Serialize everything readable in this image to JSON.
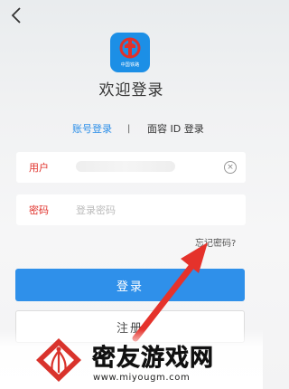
{
  "header": {
    "back_label": "<"
  },
  "app": {
    "logo_caption": "中国铁路",
    "title": "欢迎登录"
  },
  "tabs": [
    {
      "label": "账号登录",
      "active": true
    },
    {
      "label": "面容 ID 登录",
      "active": false
    }
  ],
  "tab_separator": "|",
  "form": {
    "username_label": "用户",
    "password_label": "密码",
    "password_placeholder": "登录密码",
    "clear_symbol": "×"
  },
  "forgot_password": "忘记密码?",
  "buttons": {
    "login": "登录",
    "register": "注册"
  },
  "watermark": {
    "brand": "密友游戏网",
    "url": "www.miyougm.com"
  },
  "colors": {
    "accent_blue": "#2f90ea",
    "label_red": "#e0312b",
    "arrow_red": "#e5322b",
    "logo_red": "#e0312b"
  }
}
